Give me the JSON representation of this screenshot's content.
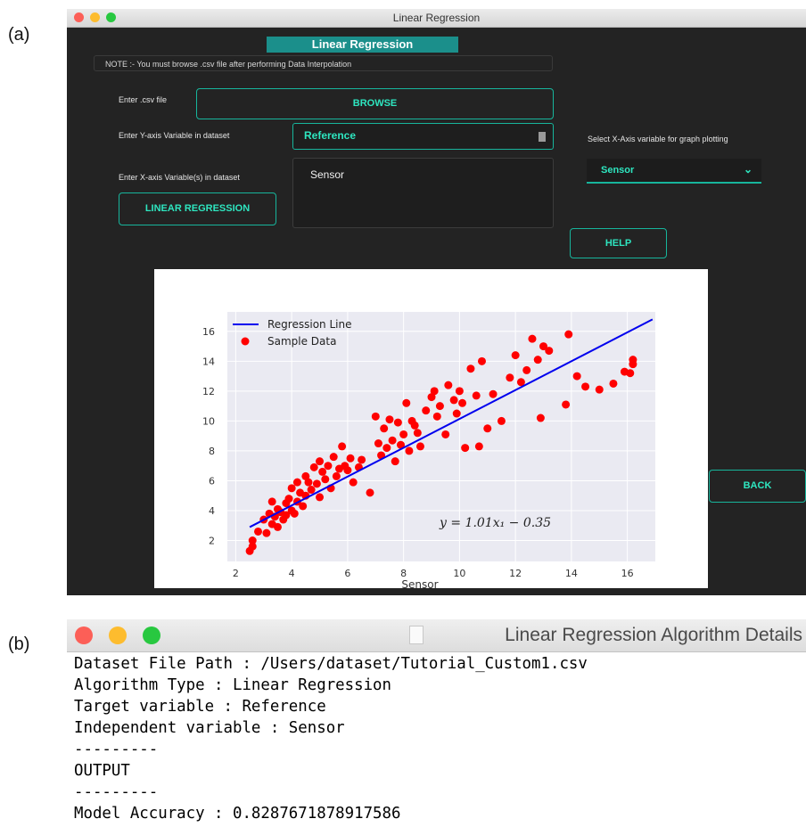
{
  "panel_labels": {
    "a": "(a)",
    "b": "(b)"
  },
  "main_window": {
    "title": "Linear Regression",
    "banner": "Linear Regression",
    "note": "NOTE :- You must browse .csv file after performing Data Interpolation",
    "csv_label": "Enter .csv file",
    "browse_button": "BROWSE",
    "y_label": "Enter Y-axis Variable in dataset",
    "y_value": "Reference",
    "x_label": "Enter X-axis Variable(s) in dataset",
    "x_list": [
      "Sensor"
    ],
    "run_button": "LINEAR REGRESSION",
    "plot_x_label": "Select X-Axis variable for graph plotting",
    "plot_x_value": "Sensor",
    "help_button": "HELP",
    "back_button": "BACK"
  },
  "colors": {
    "accent": "#17b59c",
    "accent_text": "#2ee6c0",
    "window_bg": "#232323",
    "banner": "#1b8f8b",
    "sample_points": "#ff0000",
    "regression_line": "#0000ee",
    "plot_bg": "#eaeaf2"
  },
  "chart_data": {
    "type": "scatter",
    "xlabel": "Sensor",
    "ylabel": "",
    "xlim": [
      1.7,
      17.0
    ],
    "ylim": [
      0.6,
      17.3
    ],
    "xticks": [
      2,
      4,
      6,
      8,
      10,
      12,
      14,
      16
    ],
    "yticks": [
      2,
      4,
      6,
      8,
      10,
      12,
      14,
      16
    ],
    "grid": true,
    "legend_position": "top-left",
    "annotation": "y = 1.01x₁ − 0.35",
    "series": [
      {
        "name": "Sample Data",
        "type": "scatter",
        "x": [
          2.5,
          2.6,
          2.6,
          2.8,
          3.0,
          3.1,
          3.2,
          3.3,
          3.3,
          3.4,
          3.5,
          3.5,
          3.6,
          3.7,
          3.8,
          3.8,
          3.9,
          4.0,
          4.0,
          4.1,
          4.2,
          4.2,
          4.3,
          4.4,
          4.5,
          4.5,
          4.6,
          4.7,
          4.8,
          4.9,
          5.0,
          5.0,
          5.1,
          5.2,
          5.3,
          5.4,
          5.5,
          5.6,
          5.7,
          5.8,
          5.9,
          6.0,
          6.1,
          6.2,
          6.4,
          6.5,
          6.8,
          7.0,
          7.1,
          7.2,
          7.3,
          7.4,
          7.5,
          7.6,
          7.7,
          7.8,
          7.9,
          8.0,
          8.1,
          8.2,
          8.3,
          8.4,
          8.5,
          8.6,
          8.8,
          9.0,
          9.1,
          9.2,
          9.3,
          9.5,
          9.6,
          9.8,
          9.9,
          10.0,
          10.1,
          10.2,
          10.4,
          10.6,
          10.7,
          10.8,
          11.0,
          11.2,
          11.5,
          11.8,
          12.0,
          12.2,
          12.4,
          12.6,
          12.8,
          12.9,
          13.0,
          13.2,
          13.8,
          13.9,
          14.2,
          14.5,
          15.0,
          15.5,
          15.9,
          16.1,
          16.2,
          16.2
        ],
        "y": [
          1.3,
          2.0,
          1.6,
          2.6,
          3.4,
          2.5,
          3.8,
          4.6,
          3.1,
          3.6,
          4.1,
          2.9,
          3.9,
          3.4,
          4.5,
          3.7,
          4.8,
          5.5,
          4.0,
          3.8,
          5.9,
          4.6,
          5.2,
          4.3,
          6.3,
          5.0,
          5.9,
          5.4,
          6.9,
          5.8,
          7.3,
          4.9,
          6.6,
          6.1,
          7.0,
          5.5,
          7.6,
          6.3,
          6.8,
          8.3,
          7.0,
          6.7,
          7.5,
          5.9,
          6.9,
          7.4,
          5.2,
          10.3,
          8.5,
          7.7,
          9.5,
          8.2,
          10.1,
          8.7,
          7.3,
          9.9,
          8.4,
          9.1,
          11.2,
          8.0,
          10.0,
          9.7,
          9.2,
          8.3,
          10.7,
          11.6,
          12.0,
          10.3,
          11.0,
          9.1,
          12.4,
          11.4,
          10.5,
          12.0,
          11.2,
          8.2,
          13.5,
          11.7,
          8.3,
          14.0,
          9.5,
          11.8,
          10.0,
          12.9,
          14.4,
          12.6,
          13.4,
          15.5,
          14.1,
          10.2,
          15.0,
          14.7,
          11.1,
          15.8,
          13.0,
          12.3,
          12.1,
          12.5,
          13.3,
          13.2,
          13.8,
          14.1
        ]
      },
      {
        "name": "Regression Line",
        "type": "line",
        "x": [
          2.5,
          16.9
        ],
        "y": [
          2.9,
          16.8
        ]
      }
    ]
  },
  "details_window": {
    "title": "Linear Regression Algorithm Details",
    "lines": [
      "Dataset File Path : /Users/dataset/Tutorial_Custom1.csv",
      "Algorithm Type : Linear Regression",
      "Target variable : Reference",
      "Independent variable : Sensor",
      "---------",
      "OUTPUT",
      "---------",
      "Model Accuracy : 0.8287671878917586"
    ]
  }
}
